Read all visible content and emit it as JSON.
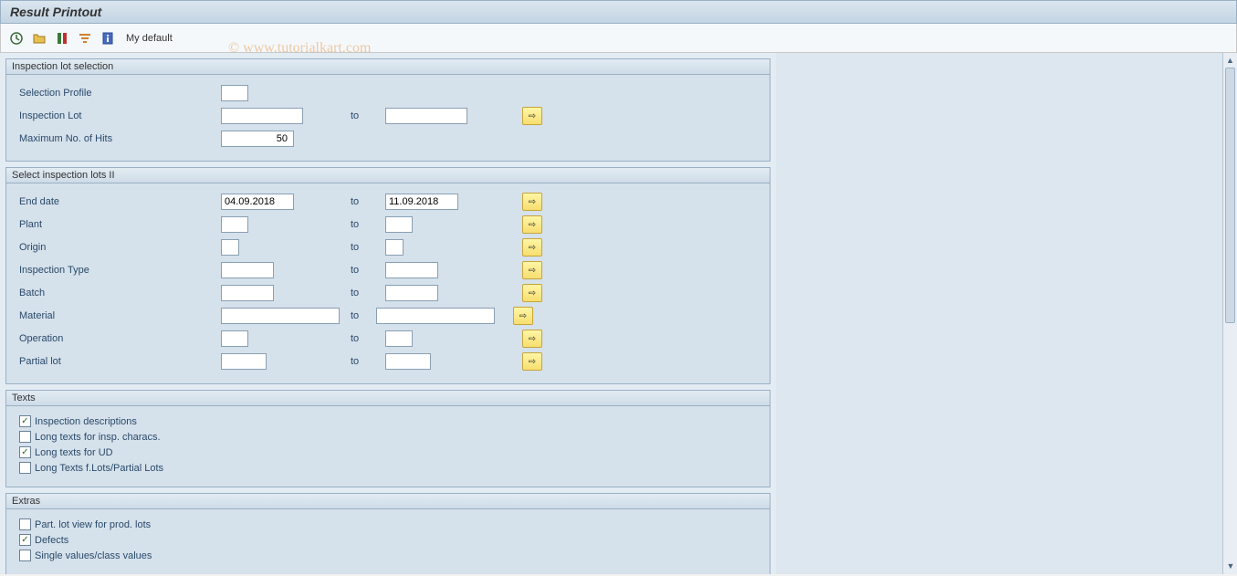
{
  "title": "Result Printout",
  "watermark": "© www.tutorialkart.com",
  "toolbar": {
    "my_default": "My default"
  },
  "groups": {
    "inspection_lot_selection": {
      "title": "Inspection lot selection",
      "selection_profile_label": "Selection Profile",
      "selection_profile_value": "",
      "inspection_lot_label": "Inspection Lot",
      "inspection_lot_from": "",
      "inspection_lot_to_label": "to",
      "inspection_lot_to": "",
      "max_hits_label": "Maximum No. of Hits",
      "max_hits_value": "50"
    },
    "select_inspection_lots_ii": {
      "title": "Select inspection lots II",
      "to_label": "to",
      "end_date_label": "End date",
      "end_date_from": "04.09.2018",
      "end_date_to": "11.09.2018",
      "plant_label": "Plant",
      "plant_from": "",
      "plant_to": "",
      "origin_label": "Origin",
      "origin_from": "",
      "origin_to": "",
      "inspection_type_label": "Inspection Type",
      "inspection_type_from": "",
      "inspection_type_to": "",
      "batch_label": "Batch",
      "batch_from": "",
      "batch_to": "",
      "material_label": "Material",
      "material_from": "",
      "material_to": "",
      "operation_label": "Operation",
      "operation_from": "",
      "operation_to": "",
      "partial_lot_label": "Partial lot",
      "partial_lot_from": "",
      "partial_lot_to": ""
    },
    "texts": {
      "title": "Texts",
      "inspection_descriptions": {
        "label": "Inspection descriptions",
        "checked": true
      },
      "long_texts_insp_characs": {
        "label": "Long texts for insp. characs.",
        "checked": false
      },
      "long_texts_ud": {
        "label": "Long texts for UD",
        "checked": true
      },
      "long_texts_lots_partial": {
        "label": "Long Texts f.Lots/Partial Lots",
        "checked": false
      }
    },
    "extras": {
      "title": "Extras",
      "part_lot_view": {
        "label": "Part. lot view for prod. lots",
        "checked": false
      },
      "defects": {
        "label": "Defects",
        "checked": true
      },
      "single_values": {
        "label": "Single values/class values",
        "checked": false
      }
    }
  }
}
